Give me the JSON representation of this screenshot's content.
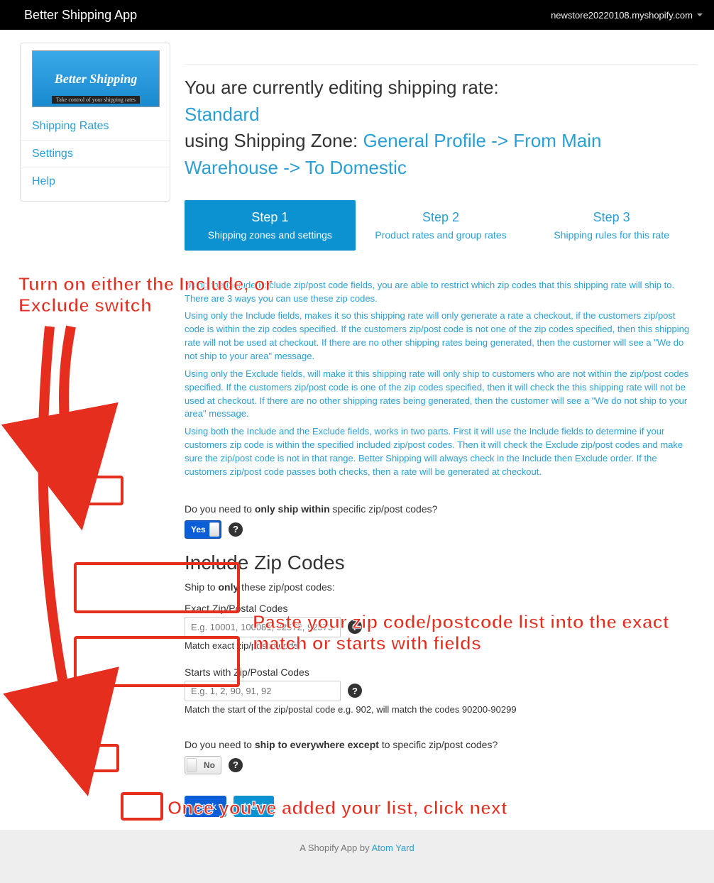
{
  "topbar": {
    "title": "Better Shipping App",
    "store": "newstore20220108.myshopify.com"
  },
  "sidebar": {
    "logo_text": "Better Shipping",
    "logo_tag": "Take control of your shipping rates",
    "items": [
      {
        "label": "Shipping Rates"
      },
      {
        "label": "Settings"
      },
      {
        "label": "Help"
      }
    ]
  },
  "heading": {
    "prefix": "You are currently editing shipping rate:",
    "rate_name": "Standard",
    "zone_prefix": "using Shipping Zone: ",
    "zone_path": "General Profile -> From Main Warehouse -> To Domestic"
  },
  "steps": [
    {
      "title": "Step 1",
      "sub": "Shipping zones and settings",
      "active": true
    },
    {
      "title": "Step 2",
      "sub": "Product rates and group rates",
      "active": false
    },
    {
      "title": "Step 3",
      "sub": "Shipping rules for this rate",
      "active": false
    }
  ],
  "explainer": {
    "p1": "Using the Include/Exclude zip/post code fields, you are able to restrict which zip codes that this shipping rate will ship to. There are 3 ways you can use these zip codes.",
    "p2": "Using only the Include fields, makes it so this shipping rate will only generate a rate a checkout, if the customers zip/post code is within the zip codes specified. If the customers zip/post code is not one of the zip codes specified, then this shipping rate will not be used at checkout. If there are no other shipping rates being generated, then the customer will see a \"We do not ship to your area\" message.",
    "p3": "Using only the Exclude fields, will make it this shipping rate will only ship to customers who are not within the zip/post codes specified. If the customers zip/post code is one of the zip codes specified, then it will check the this shipping rate will not be used at checkout. If there are no other shipping rates being generated, then the customer will see a \"We do not ship to your area\" message.",
    "p4": "Using both the Include and the Exclude fields, works in two parts. First it will use the Include fields to determine if your customers zip code is within the specified included zip/post codes. Then it will check the Exclude zip/post codes and make sure the zip/post code is not in that range. Better Shipping will always check in the Include then Exclude order. If the customers zip/post code passes both checks, then a rate will be generated at checkout."
  },
  "include": {
    "question_pre": "Do you need to ",
    "question_bold": "only ship within",
    "question_post": " specific zip/post codes?",
    "toggle_label": "Yes",
    "section_title": "Include Zip Codes",
    "ship_pre": "Ship to ",
    "ship_bold": "only",
    "ship_post": " these zip/post codes:",
    "exact_label": "Exact Zip/Postal Codes",
    "exact_placeholder": "E.g. 10001, 100081, 92572, 92573",
    "exact_hint": "Match exact zip/postal code.",
    "starts_label": "Starts with Zip/Postal Codes",
    "starts_placeholder": "E.g. 1, 2, 90, 91, 92",
    "starts_hint": "Match the start of the zip/postal code e.g. 902, will match the codes 90200-90299"
  },
  "exclude": {
    "question_pre": "Do you need to ",
    "question_bold": "ship to everywhere except",
    "question_post": " to specific zip/post codes?",
    "toggle_label": "No"
  },
  "buttons": {
    "back": "Back",
    "next": "Next"
  },
  "footer": {
    "text": "A Shopify App by ",
    "link": "Atom Yard"
  },
  "annotations": {
    "a1": "Turn on either the Include, or Exclude switch",
    "a2": "Paste your zip code/postcode list into the exact match or starts with fields",
    "a3": "Once you've added your list, click next"
  },
  "glyphs": {
    "help": "?"
  }
}
